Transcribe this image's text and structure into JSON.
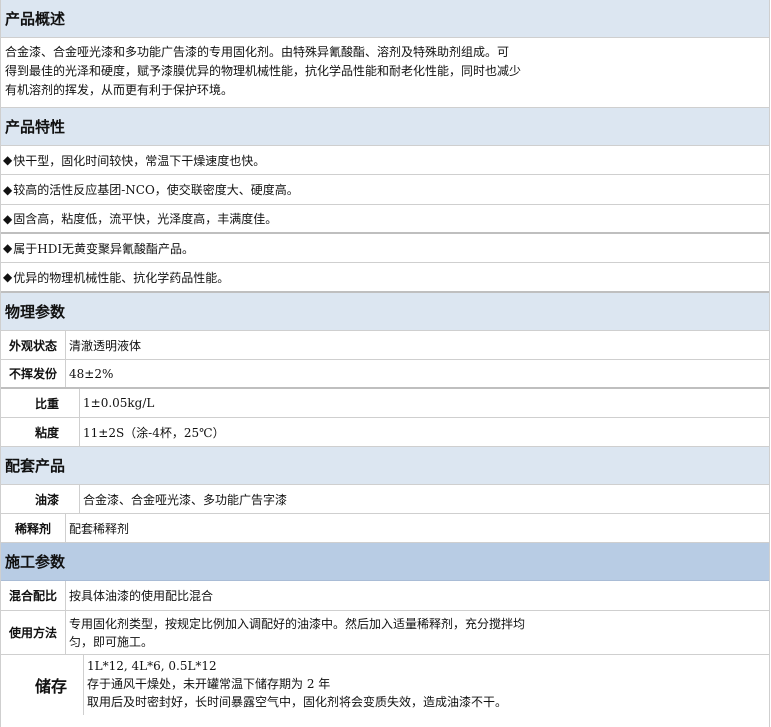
{
  "overview": {
    "title": "产品概述",
    "lines": [
      "合金漆、合金哑光漆和多功能广告漆的专用固化剂。由特殊异氰酸酯、溶剂及特殊助剂组成。可",
      "得到最佳的光泽和硬度，赋予漆膜优异的物理机械性能，抗化学品性能和耐老化性能，同时也减少",
      "有机溶剂的挥发，从而更有利于保护环境。"
    ]
  },
  "features": {
    "title": "产品特性",
    "bullet": "◆",
    "items": [
      "快干型，固化时间较快，常温下干燥速度也快。",
      "较高的活性反应基团-NCO，使交联密度大、硬度高。",
      "固含高，粘度低，流平快，光泽度高，丰满度佳。",
      "属于HDI无黄变聚异氰酸酯产品。",
      "优异的物理机械性能、抗化学药品性能。"
    ]
  },
  "physical": {
    "title": "物理参数",
    "rows": [
      {
        "key": "外观状态",
        "value": "清澈透明液体"
      },
      {
        "key": "不挥发份",
        "value": "48±2%"
      },
      {
        "key": "比重",
        "value": "1±0.05kg/L"
      },
      {
        "key": "粘度",
        "value": "11±2S（涂-4杯，25℃）"
      }
    ]
  },
  "matching": {
    "title": "配套产品",
    "rows": [
      {
        "key": "油漆",
        "value": "合金漆、合金哑光漆、多功能广告字漆"
      },
      {
        "key": "稀释剂",
        "value": "配套稀释剂"
      }
    ]
  },
  "construction": {
    "title": "施工参数",
    "mix": {
      "key": "混合配比",
      "value": "按具体油漆的使用配比混合"
    },
    "usage": {
      "key": "使用方法",
      "lines": [
        "专用固化剂类型，按规定比例加入调配好的油漆中。然后加入适量稀释剂，充分搅拌均",
        "匀，即可施工。"
      ]
    },
    "storage": {
      "key": "储存",
      "lines": [
        "1L*12, 4L*6, 0.5L*12",
        "存于通风干燥处，未开罐常温下储存期为 2 年",
        "取用后及时密封好，长时间暴露空气中，固化剂将会变质失效，造成油漆不干。"
      ]
    }
  }
}
